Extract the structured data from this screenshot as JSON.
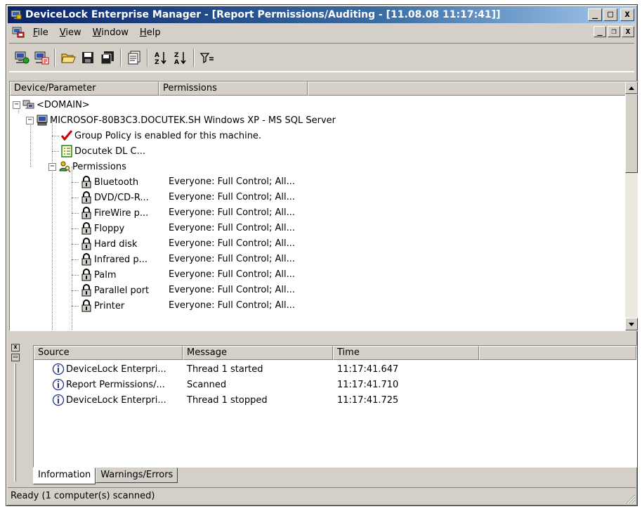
{
  "window": {
    "title": "DeviceLock Enterprise Manager - [Report Permissions/Auditing - [11.08.08 11:17:41]]",
    "caption_buttons": [
      "_",
      "□",
      "x"
    ]
  },
  "menubar": {
    "items": [
      {
        "label": "File",
        "accel": "F",
        "rest": "ile"
      },
      {
        "label": "View",
        "accel": "V",
        "rest": "iew"
      },
      {
        "label": "Window",
        "accel": "W",
        "rest": "indow"
      },
      {
        "label": "Help",
        "accel": "H",
        "rest": "elp"
      }
    ],
    "mdi_buttons": [
      "_",
      "❐",
      "x"
    ]
  },
  "toolbar": {
    "buttons": [
      "connect-icon",
      "report-icon",
      "open-icon",
      "save-icon",
      "save-all-icon",
      "properties-icon",
      "sort-ascending-icon",
      "sort-descending-icon",
      "filter-icon"
    ]
  },
  "tree_pane": {
    "columns": [
      "Device/Parameter",
      "Permissions"
    ],
    "rows": {
      "domain": "<DOMAIN>",
      "machine": "MICROSOF-80B3C3.DOCUTEK.SH Windows XP - MS SQL Server",
      "group_policy": "Group Policy is enabled for this machine.",
      "docutek": "Docutek DL C...",
      "permissions": "Permissions"
    },
    "devices": [
      {
        "name": "Bluetooth",
        "permission": "Everyone: Full Control; All..."
      },
      {
        "name": "DVD/CD-R...",
        "permission": "Everyone: Full Control; All..."
      },
      {
        "name": "FireWire p...",
        "permission": "Everyone: Full Control; All..."
      },
      {
        "name": "Floppy",
        "permission": "Everyone: Full Control; All..."
      },
      {
        "name": "Hard disk",
        "permission": "Everyone: Full Control; All..."
      },
      {
        "name": "Infrared p...",
        "permission": "Everyone: Full Control; All..."
      },
      {
        "name": "Palm",
        "permission": "Everyone: Full Control; All..."
      },
      {
        "name": "Parallel port",
        "permission": "Everyone: Full Control; All..."
      },
      {
        "name": "Printer",
        "permission": "Everyone: Full Control; All..."
      }
    ]
  },
  "log_pane": {
    "columns": [
      "Source",
      "Message",
      "Time"
    ],
    "entries": [
      {
        "source": "DeviceLock Enterpri...",
        "message": "Thread 1 started",
        "time": "11:17:41.647"
      },
      {
        "source": "Report Permissions/...",
        "message": "Scanned",
        "time": "11:17:41.710"
      },
      {
        "source": "DeviceLock Enterpri...",
        "message": "Thread 1 stopped",
        "time": "11:17:41.725"
      }
    ],
    "tabs": [
      "Information",
      "Warnings/Errors"
    ]
  },
  "statusbar": {
    "text": "Ready (1 computer(s) scanned)"
  },
  "colors": {
    "title_gradient_start": "#0a246a",
    "face": "#d4d0c8",
    "check_red": "#cc0000"
  }
}
